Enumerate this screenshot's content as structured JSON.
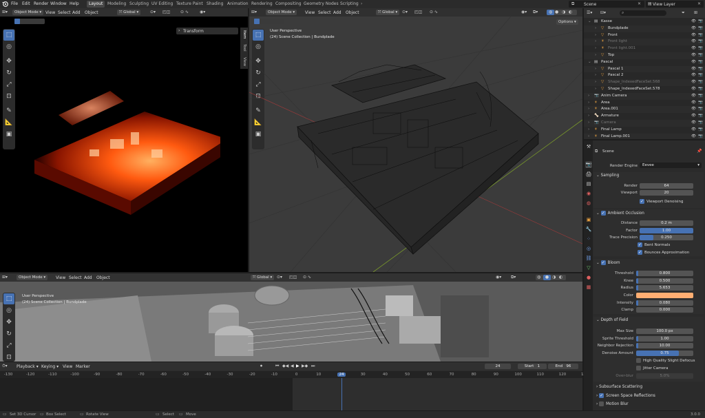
{
  "menus": [
    "File",
    "Edit",
    "Render",
    "Window",
    "Help"
  ],
  "workspaces": [
    "Layout",
    "Modeling",
    "Sculpting",
    "UV Editing",
    "Texture Paint",
    "Shading",
    "Animation",
    "Rendering",
    "Compositing",
    "Geometry Nodes",
    "Scripting"
  ],
  "active_workspace": "Layout",
  "scene_name": "Scene",
  "view_layer": "View Layer",
  "viewport_header": {
    "mode": "Object Mode",
    "view": "View",
    "select": "Select",
    "add": "Add",
    "object": "Object",
    "orientation": "Global",
    "options": "Options"
  },
  "left_viewport": {
    "transform_panel": "Transform",
    "side_tabs": [
      "Item",
      "Tool",
      "View"
    ]
  },
  "right_viewport": {
    "perspective": "User Perspective",
    "collection": "(24) Scene Collection | Bundplade"
  },
  "bottom_viewport": {
    "perspective": "User Perspective",
    "collection": "(24) Scene Collection | Bundplade"
  },
  "outliner": {
    "search_placeholder": "",
    "rows": [
      {
        "name": "Kasse",
        "indent": 0,
        "expanded": true,
        "color": "#ddd"
      },
      {
        "name": "Bundplade",
        "indent": 1,
        "color": "#ddd"
      },
      {
        "name": "Front",
        "indent": 1,
        "color": "#ddd"
      },
      {
        "name": "Front light",
        "indent": 1,
        "color": "#777"
      },
      {
        "name": "Front light.001",
        "indent": 1,
        "color": "#777"
      },
      {
        "name": "Top",
        "indent": 1,
        "color": "#ddd"
      },
      {
        "name": "Pascal",
        "indent": 0,
        "expanded": true,
        "color": "#ddd"
      },
      {
        "name": "Pascal 1",
        "indent": 1,
        "color": "#ddd"
      },
      {
        "name": "Pascal 2",
        "indent": 1,
        "color": "#ddd"
      },
      {
        "name": "Shape_IndexedFaceSet.568",
        "indent": 1,
        "color": "#777"
      },
      {
        "name": "Shape_IndexedFaceSet.578",
        "indent": 1,
        "color": "#ddd"
      },
      {
        "name": "Anim Camera",
        "indent": 0,
        "color": "#ddd"
      },
      {
        "name": "Area",
        "indent": 0,
        "color": "#ddd"
      },
      {
        "name": "Area.001",
        "indent": 0,
        "color": "#ddd"
      },
      {
        "name": "Armature",
        "indent": 0,
        "color": "#ddd"
      },
      {
        "name": "Camera",
        "indent": 0,
        "color": "#777"
      },
      {
        "name": "Final Lamp",
        "indent": 0,
        "color": "#ddd"
      },
      {
        "name": "Final Lamp.001",
        "indent": 0,
        "color": "#ddd"
      }
    ]
  },
  "properties": {
    "context": "Scene",
    "render_engine_label": "Render Engine",
    "render_engine": "Eevee",
    "sampling": {
      "title": "Sampling",
      "render_label": "Render",
      "render": "64",
      "viewport_label": "Viewport",
      "viewport": "20",
      "denoise": "Viewport Denoising"
    },
    "ao": {
      "title": "Ambient Occlusion",
      "distance_label": "Distance",
      "distance": "0.2 m",
      "factor_label": "Factor",
      "factor": "1.00",
      "factor_frac": 1.0,
      "trace_label": "Trace Precision",
      "trace": "0.250",
      "trace_frac": 0.25,
      "bent": "Bent Normals",
      "bounces": "Bounces Approximation"
    },
    "bloom": {
      "title": "Bloom",
      "threshold_label": "Threshold",
      "threshold": "0.800",
      "knee_label": "Knee",
      "knee": "0.500",
      "knee_frac": 0.5,
      "radius_label": "Radius",
      "radius": "5.653",
      "color_label": "Color",
      "color": "#ffae72",
      "intensity_label": "Intensity",
      "intensity": "0.080",
      "clamp_label": "Clamp",
      "clamp": "0.000"
    },
    "dof": {
      "title": "Depth of Field",
      "maxsize_label": "Max Size",
      "maxsize": "100.0 px",
      "sprite_label": "Sprite Threshold",
      "sprite": "1.00",
      "neighbor_label": "Neighbor Rejection",
      "neighbor": "10.00",
      "denoise_label": "Denoise Amount",
      "denoise": "0.75",
      "denoise_frac": 0.75,
      "hq": "High Quality Slight Defocus",
      "jitter": "Jitter Camera",
      "overblur_label": "Over-blur",
      "overblur": "5.0%"
    },
    "collapsed": [
      "Subsurface Scattering",
      "Screen Space Reflections",
      "Motion Blur"
    ]
  },
  "timeline": {
    "menus": [
      "Playback",
      "Keying",
      "View",
      "Marker"
    ],
    "current_frame": "24",
    "start_label": "Start",
    "start": "1",
    "end_label": "End",
    "end": "96",
    "ticks": [
      "-130",
      "-120",
      "-110",
      "-100",
      "-90",
      "-80",
      "-70",
      "-60",
      "-50",
      "-40",
      "-30",
      "-20",
      "-10",
      "0",
      "10",
      "20",
      "24",
      "30",
      "40",
      "50",
      "60",
      "70",
      "80",
      "90",
      "100",
      "110",
      "120",
      "130"
    ]
  },
  "statusbar": {
    "items": [
      "Set 3D Cursor",
      "Box Select",
      "Rotate View",
      "Select",
      "Move"
    ],
    "version": "3.0.0"
  },
  "colors": {
    "accent": "#4772b3",
    "header": "#303030",
    "panel": "#2b2b2b"
  }
}
